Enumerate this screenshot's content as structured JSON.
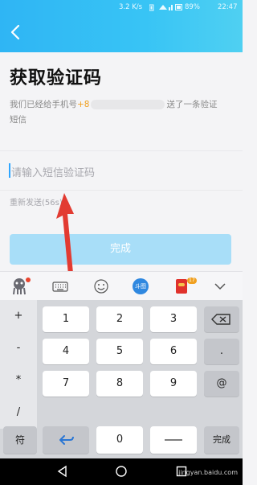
{
  "status_bar": {
    "speed": "3.2 K/s",
    "battery": "89%",
    "time": "22:47"
  },
  "page": {
    "title": "获取验证码",
    "desc_prefix": "我们已经给手机号",
    "phone_prefix": "+8",
    "desc_suffix": "送了一条验证",
    "desc_line2": "短信",
    "input_placeholder": "请输入短信验证码",
    "resend_label": "重新发送(56s)",
    "submit_label": "完成"
  },
  "ime_toolbar": {
    "icons": [
      "app-mascot-icon",
      "keyboard-icon",
      "emoji-icon",
      "badge-icon",
      "red-envelope-icon",
      "chevron-down-icon"
    ],
    "badge_text": "斗图",
    "envelope_badge": "17"
  },
  "keypad": {
    "symbols": [
      "+",
      "-",
      "*",
      "/"
    ],
    "digits": [
      [
        "1",
        "2",
        "3"
      ],
      [
        "4",
        "5",
        "6"
      ],
      [
        "7",
        "8",
        "9"
      ]
    ],
    "dot": ".",
    "at": "@",
    "bottom": {
      "fn": "符",
      "zero": "0",
      "done": "完成"
    }
  },
  "nav": {
    "icons": [
      "back-triangle-icon",
      "home-circle-icon",
      "recent-square-icon"
    ]
  },
  "watermark": "jingyan.baidu.com",
  "colors": {
    "header": "#2fb5f4",
    "button_disabled": "#a8def8",
    "cursor": "#2fa6ff",
    "phone_accent": "#f0a020"
  }
}
